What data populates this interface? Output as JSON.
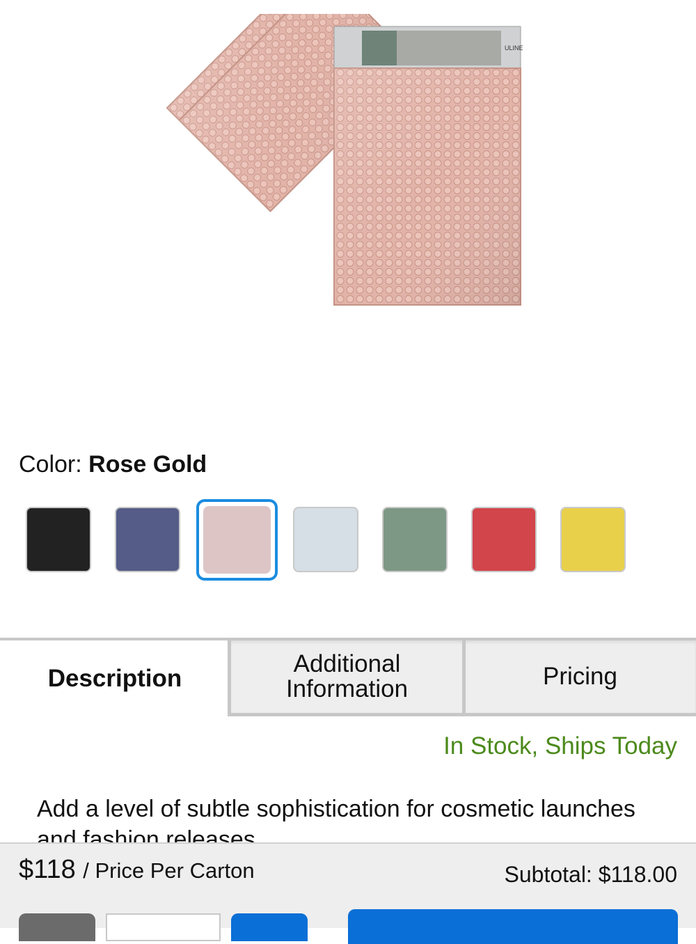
{
  "product": {
    "image_name": "rose-gold-bubble-mailers",
    "image_text": "ULINE"
  },
  "color": {
    "label": "Color:",
    "selected": "Rose Gold",
    "swatches": [
      {
        "name": "black",
        "hex": "#222222"
      },
      {
        "name": "navy",
        "hex": "#545c87"
      },
      {
        "name": "rose-gold",
        "hex": "#ddc5c6",
        "selected": true
      },
      {
        "name": "silver",
        "hex": "#d6dee6"
      },
      {
        "name": "sage-green",
        "hex": "#7d9884"
      },
      {
        "name": "red",
        "hex": "#d2454a"
      },
      {
        "name": "yellow",
        "hex": "#e9d04b"
      }
    ]
  },
  "tabs": [
    {
      "label": "Description",
      "active": true
    },
    {
      "label": "Additional Information",
      "active": false
    },
    {
      "label": "Pricing",
      "active": false
    }
  ],
  "stock_status": "In Stock, Ships Today",
  "description": "Add a level of subtle sophistication for cosmetic launches and fashion releases.",
  "bottom_bar": {
    "price": "$118",
    "price_unit": "/ Price Per Carton",
    "subtotal": "Subtotal: $118.00"
  },
  "colors": {
    "accent": "#0a6fd6",
    "stock_green": "#4c8a1c",
    "selected_ring": "#1a8ce0"
  }
}
